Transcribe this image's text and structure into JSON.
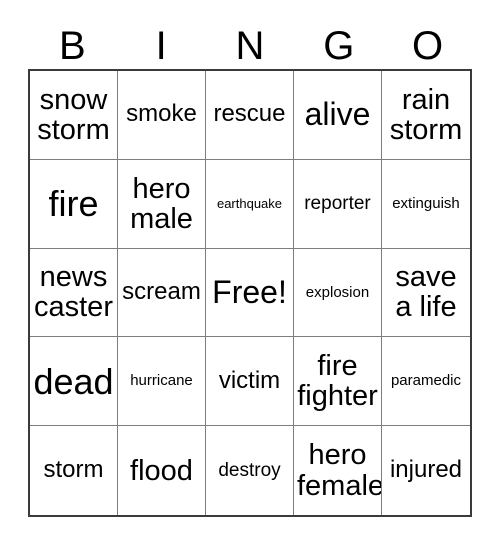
{
  "header": {
    "letters": [
      "B",
      "I",
      "N",
      "G",
      "O"
    ]
  },
  "grid": {
    "rows": 5,
    "columns": 5,
    "border_color": "#3a3a3a",
    "inner_line_color": "#7d7d7d",
    "background_color": "#ffffff",
    "text_color": "#000000",
    "cells": [
      {
        "text": "snow\nstorm",
        "size": "t-lg"
      },
      {
        "text": "smoke",
        "size": "t-md"
      },
      {
        "text": "rescue",
        "size": "t-md"
      },
      {
        "text": "alive",
        "size": "t-xl"
      },
      {
        "text": "rain\nstorm",
        "size": "t-lg"
      },
      {
        "text": "fire",
        "size": "t-xxl"
      },
      {
        "text": "hero\nmale",
        "size": "t-lg"
      },
      {
        "text": "earthquake",
        "size": "t-xxs"
      },
      {
        "text": "reporter",
        "size": "t-sm"
      },
      {
        "text": "extinguish",
        "size": "t-xs"
      },
      {
        "text": "news\ncaster",
        "size": "t-lg"
      },
      {
        "text": "scream",
        "size": "t-md"
      },
      {
        "text": "Free!",
        "size": "t-xl"
      },
      {
        "text": "explosion",
        "size": "t-xs"
      },
      {
        "text": "save\na life",
        "size": "t-lg"
      },
      {
        "text": "dead",
        "size": "t-xxl"
      },
      {
        "text": "hurricane",
        "size": "t-xs"
      },
      {
        "text": "victim",
        "size": "t-md"
      },
      {
        "text": "fire\nfighter",
        "size": "t-lg"
      },
      {
        "text": "paramedic",
        "size": "t-xs"
      },
      {
        "text": "storm",
        "size": "t-md"
      },
      {
        "text": "flood",
        "size": "t-lg"
      },
      {
        "text": "destroy",
        "size": "t-sm"
      },
      {
        "text": "hero\nfemale",
        "size": "t-lg"
      },
      {
        "text": "injured",
        "size": "t-md"
      }
    ]
  }
}
